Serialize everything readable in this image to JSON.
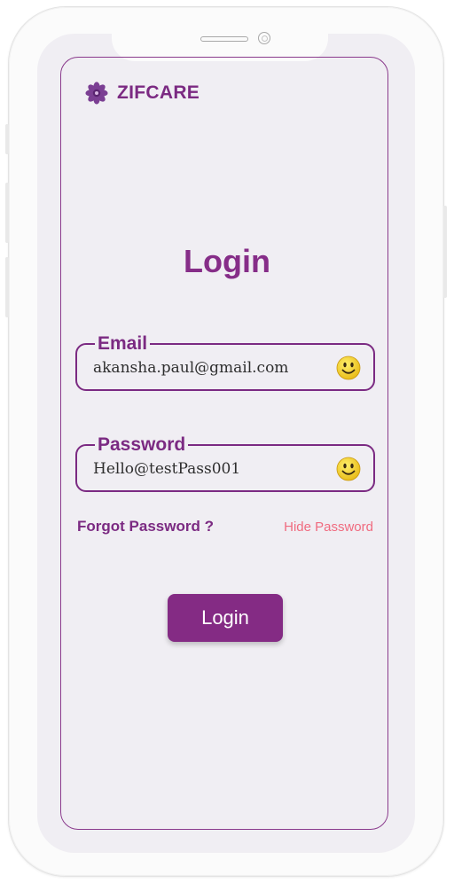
{
  "brand": {
    "name": "ZIFCARE",
    "logo_icon": "flower-icon",
    "color": "#7b2a82"
  },
  "page": {
    "title": "Login"
  },
  "email": {
    "label": "Email",
    "value": "akansha.paul@gmail.com",
    "icon": "smiley-icon"
  },
  "password": {
    "label": "Password",
    "value": "Hello@testPass001",
    "icon": "smiley-icon"
  },
  "links": {
    "forgot": "Forgot Password ?",
    "toggle_visibility": "Hide Password"
  },
  "actions": {
    "login_label": "Login"
  },
  "colors": {
    "accent": "#842b84",
    "link_pink": "#f06b7f",
    "screen_bg": "#f0eef3"
  }
}
